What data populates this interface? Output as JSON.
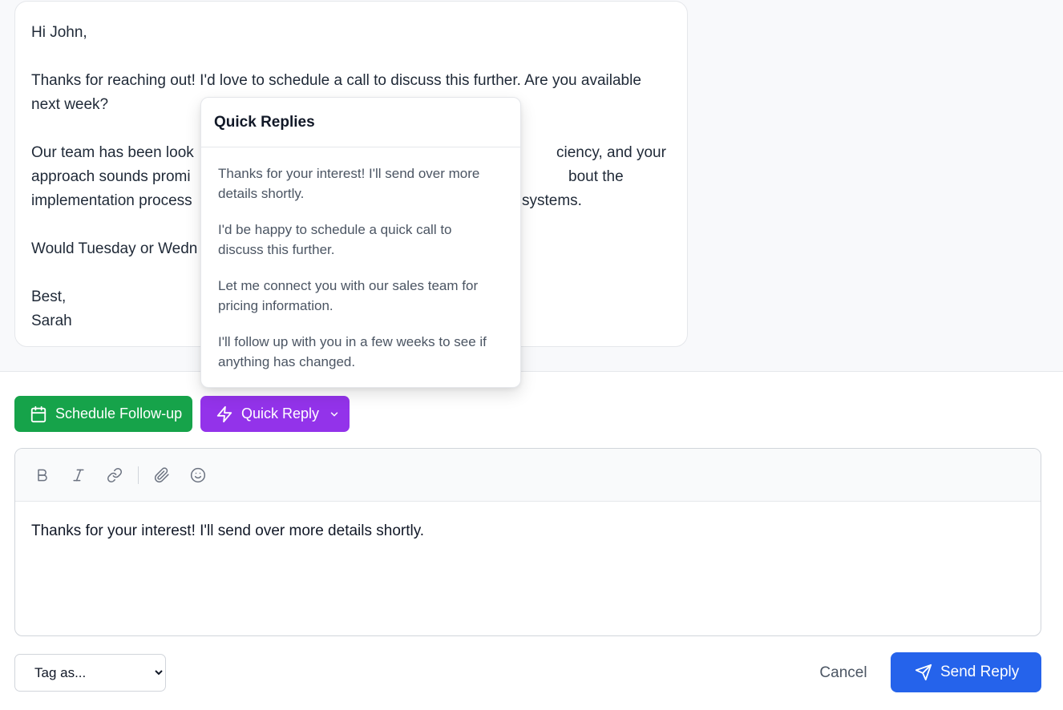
{
  "message": {
    "greeting": "Hi John,",
    "paragraph1_line1": "Thanks for reaching out! I'd love to schedule a call to discuss this further. Are you available",
    "paragraph1_line2": "next week?",
    "paragraph2_line1": "Our team has been look",
    "paragraph2_line1_tail": "ciency, and your",
    "paragraph2_line2": "approach sounds promi",
    "paragraph2_line2_tail": "bout the",
    "paragraph2_line3": "implementation process",
    "paragraph2_line3_tail": "systems.",
    "paragraph3": "Would Tuesday or Wedn",
    "signoff": "Best,",
    "signature": "Sarah"
  },
  "quick_replies": {
    "title": "Quick Replies",
    "items": [
      {
        "line1": "Thanks for your interest! I'll send over more",
        "line2": "details shortly."
      },
      {
        "line1": "I'd be happy to schedule a quick call to",
        "line2": "discuss this further."
      },
      {
        "line1": "Let me connect you with our sales team for",
        "line2": "pricing information."
      },
      {
        "line1": "I'll follow up with you in a few weeks to see if",
        "line2": "anything has changed."
      }
    ]
  },
  "actions": {
    "schedule_label": "Schedule Follow-up",
    "quick_reply_label": "Quick Reply"
  },
  "editor": {
    "tools": [
      "bold-icon",
      "italic-icon",
      "link-icon",
      "paperclip-icon",
      "smiley-icon"
    ],
    "content": "Thanks for your interest! I'll send over more details shortly."
  },
  "footer": {
    "tag_selected": "Tag as...",
    "cancel_label": "Cancel",
    "send_label": "Send Reply"
  },
  "colors": {
    "schedule": "#16a34a",
    "quick_reply": "#9333ea",
    "send": "#2563eb"
  }
}
